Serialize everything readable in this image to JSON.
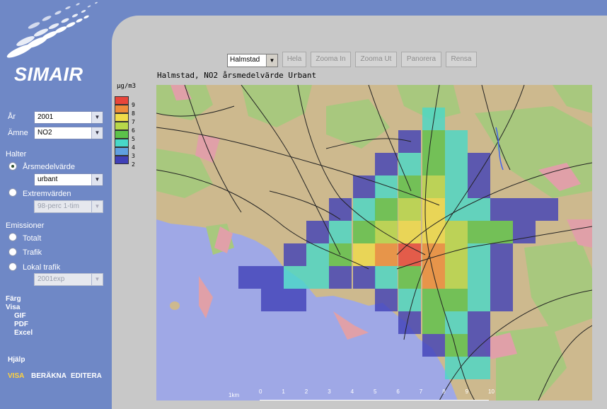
{
  "app": {
    "name": "SIMAIR"
  },
  "sidebar": {
    "year_label": "År",
    "year_value": "2001",
    "substance_label": "Ämne",
    "substance_value": "NO2",
    "halter_heading": "Halter",
    "annual_label": "Årsmedelvärde",
    "annual_select": "urbant",
    "extreme_label": "Extremvärden",
    "extreme_select": "98-perc 1-tim",
    "emissions_heading": "Emissioner",
    "emis_total": "Totalt",
    "emis_traffic": "Trafik",
    "emis_local": "Lokal trafik",
    "local_select": "2001exp",
    "color_link": "Färg",
    "show_heading": "Visa",
    "gif": "GIF",
    "pdf": "PDF",
    "excel": "Excel",
    "help": "Hjälp",
    "nav_show": "VISA",
    "nav_calc": "BERÄKNA",
    "nav_edit": "EDITERA",
    "nav_active_color": "#ffd23c"
  },
  "toolbar": {
    "city": "Halmstad",
    "buttons": [
      "Hela",
      "Zooma In",
      "Zooma Ut",
      "Panorera",
      "Rensa"
    ]
  },
  "map": {
    "title": "Halmstad, NO2 årsmedelvärde Urbant",
    "unit": "µg/m3",
    "legend": [
      {
        "value": "9",
        "color": "#e8453a"
      },
      {
        "value": "8",
        "color": "#ee8c3a"
      },
      {
        "value": "7",
        "color": "#f0dc4a"
      },
      {
        "value": "6",
        "color": "#b8d84a"
      },
      {
        "value": "5",
        "color": "#5cc24a"
      },
      {
        "value": "4",
        "color": "#48d8c8"
      },
      {
        "value": "3",
        "color": "#60a0e0"
      },
      {
        "value": "2",
        "color": "#4040b8"
      }
    ],
    "scale_unit": "1km",
    "scale_ticks": [
      "0",
      "1",
      "2",
      "3",
      "4",
      "5",
      "6",
      "7",
      "8",
      "9",
      "10"
    ],
    "colors": {
      "sea": "#9fa8e6",
      "land": "#cdb98e",
      "green": "#a8c87e",
      "urban": "#e0a0a8",
      "road": "#222222"
    }
  }
}
